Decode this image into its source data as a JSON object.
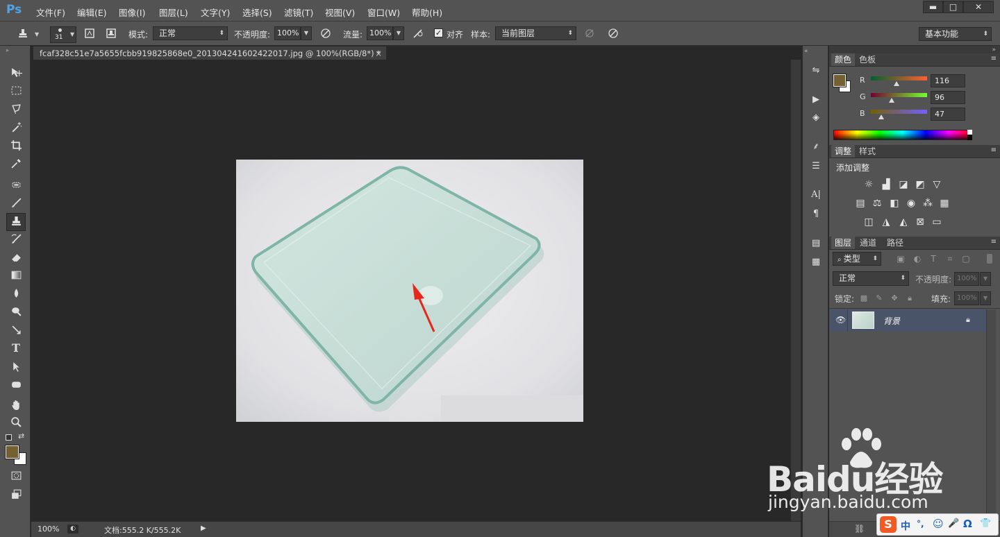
{
  "app": {
    "logo": "Ps"
  },
  "menu": [
    "文件(F)",
    "编辑(E)",
    "图像(I)",
    "图层(L)",
    "文字(Y)",
    "选择(S)",
    "滤镜(T)",
    "视图(V)",
    "窗口(W)",
    "帮助(H)"
  ],
  "window_buttons": {
    "minimize": "▬",
    "maximize": "□",
    "close": "✕"
  },
  "options_bar": {
    "brush_size": "31",
    "mode_label": "模式:",
    "mode_value": "正常",
    "opacity_label": "不透明度:",
    "opacity_value": "100%",
    "flow_label": "流量:",
    "flow_value": "100%",
    "aligned_label": "对齐",
    "sample_label": "样本:",
    "sample_value": "当前图层",
    "workspace": "基本功能"
  },
  "document": {
    "tab_title": "fcaf328c51e7a5655fcbb919825868e0_201304241602422017.jpg @ 100%(RGB/8*) *",
    "tab_close": "×",
    "zoom": "100%",
    "doc_size": "文档:555.2 K/555.2K"
  },
  "color_panel": {
    "tabs": [
      "颜色",
      "色板"
    ],
    "channels": [
      {
        "name": "R",
        "value": "116",
        "fraction": 0.455
      },
      {
        "name": "G",
        "value": "96",
        "fraction": 0.376
      },
      {
        "name": "B",
        "value": "47",
        "fraction": 0.184
      }
    ],
    "foreground_color": "#746030",
    "background_color": "#ffffff"
  },
  "adjust_panel": {
    "tabs": [
      "调整",
      "样式"
    ],
    "title": "添加调整"
  },
  "layers_panel": {
    "tabs": [
      "图层",
      "通道",
      "路径"
    ],
    "filter_kind": "类型",
    "blend_mode": "正常",
    "opacity_label": "不透明度:",
    "opacity_value": "100%",
    "lock_label": "锁定:",
    "fill_label": "填充:",
    "fill_value": "100%",
    "layers": [
      {
        "name": "背景",
        "visible": true,
        "locked": true
      }
    ]
  },
  "watermark": {
    "brand": "Baidu经验",
    "url": "jingyan.baidu.com"
  },
  "ime_bar": {
    "items": [
      "S",
      "中",
      "°,",
      "☺",
      "🎤",
      "Ω",
      "👕"
    ]
  },
  "colors": {
    "accent_arrow": "#e8261a",
    "selection": "#4a5468"
  }
}
